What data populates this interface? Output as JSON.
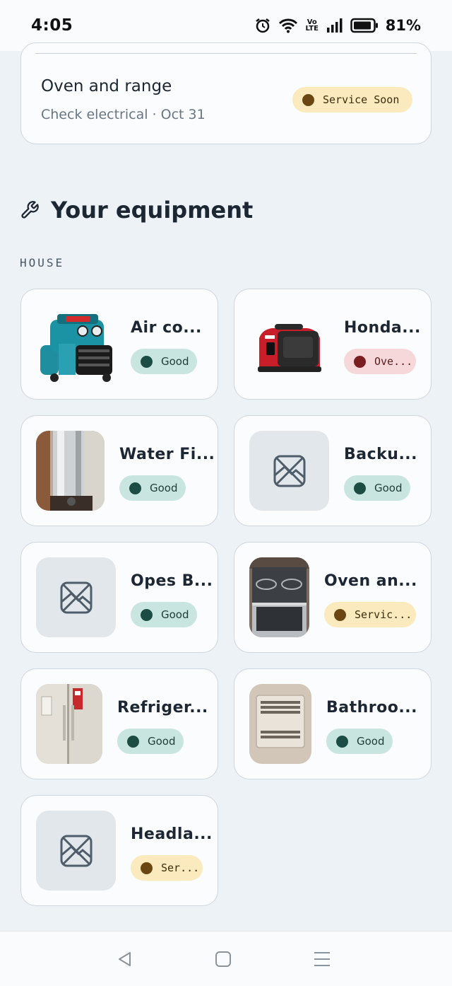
{
  "status_bar": {
    "time": "4:05",
    "network_label": "Vo LTE",
    "battery": "81%"
  },
  "upcoming_card": {
    "title": "Oven and range",
    "subtitle": "Check electrical · Oct 31",
    "status": "Service Soon"
  },
  "section": {
    "title": "Your equipment",
    "icon": "wrench-icon",
    "group_label": "HOUSE"
  },
  "equipment": [
    {
      "name": "Air co...",
      "status": "Good",
      "status_type": "good",
      "thumb": "air-compressor-photo"
    },
    {
      "name": "Honda...",
      "status": "Ove...",
      "status_type": "over",
      "thumb": "generator-photo"
    },
    {
      "name": "Water Fi...",
      "status": "Good",
      "status_type": "good",
      "thumb": "water-filter-photo"
    },
    {
      "name": "Backu...",
      "status": "Good",
      "status_type": "good",
      "thumb": "image-placeholder-icon"
    },
    {
      "name": "Opes B...",
      "status": "Good",
      "status_type": "good",
      "thumb": "image-placeholder-icon"
    },
    {
      "name": "Oven an...",
      "status": "Servic...",
      "status_type": "soon",
      "thumb": "oven-photo"
    },
    {
      "name": "Refriger...",
      "status": "Good",
      "status_type": "good",
      "thumb": "refrigerator-photo"
    },
    {
      "name": "Bathroo...",
      "status": "Good",
      "status_type": "good",
      "thumb": "bathroom-fan-photo"
    },
    {
      "name": "Headla...",
      "status": "Ser...",
      "status_type": "soon",
      "thumb": "image-placeholder-icon"
    }
  ],
  "nav": {
    "back": "back-icon",
    "home": "home-icon",
    "menu": "menu-icon"
  },
  "colors": {
    "background": "#edf2f7",
    "good": "#c8e6df",
    "soon": "#faeabd",
    "over": "#f7d8da"
  }
}
